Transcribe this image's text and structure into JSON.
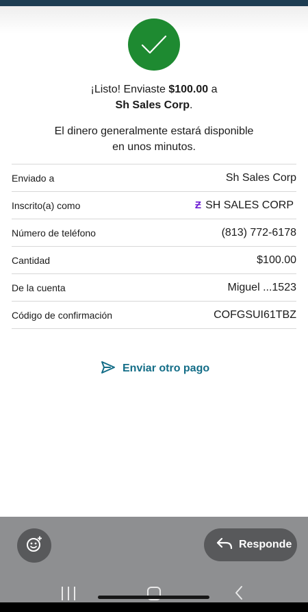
{
  "confirmation": {
    "headline_prefix": "¡Listo! Enviaste ",
    "amount": "$100.00",
    "headline_mid": " a",
    "recipient": "Sh Sales Corp",
    "headline_end": ".",
    "subtext_line1": "El dinero generalmente estará disponible",
    "subtext_line2": "en unos minutos."
  },
  "details": [
    {
      "label": "Enviado a",
      "value": "Sh Sales Corp"
    },
    {
      "label": "Inscrito(a) como",
      "value": "SH SALES CORP",
      "icon": "zelle-icon"
    },
    {
      "label": "Número de teléfono",
      "value": "(813) 772-6178"
    },
    {
      "label": "Cantidad",
      "value": "$100.00"
    },
    {
      "label": "De la cuenta",
      "value": "Miguel ...1523"
    },
    {
      "label": "Código de confirmación",
      "value": "COFGSUI61TBZ"
    }
  ],
  "actions": {
    "send_again_label": "Enviar otro pago",
    "send_again_icon": "paper-plane-icon"
  },
  "bottom_bar": {
    "reply_label": "Responde",
    "reply_icon": "reply-arrow-icon",
    "emoji_icon": "emoji-add-icon"
  },
  "colors": {
    "success_green": "#1e8a31",
    "link_teal": "#136d87",
    "zelle_purple": "#6d1ed4",
    "status_bar": "#1d3d52"
  }
}
